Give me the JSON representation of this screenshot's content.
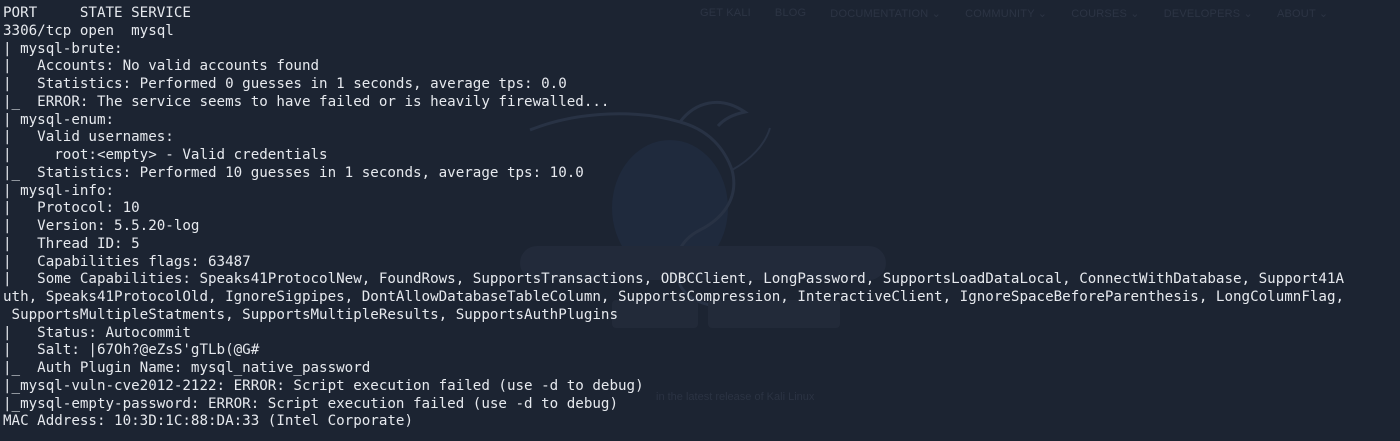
{
  "background": {
    "nav_items": [
      "GET KALI",
      "BLOG",
      "DOCUMENTATION ⌄",
      "COMMUNITY ⌄",
      "COURSES ⌄",
      "DEVELOPERS ⌄",
      "ABOUT ⌄"
    ],
    "footer_text": "in the latest release of Kali Linux"
  },
  "terminal": {
    "lines": [
      "PORT     STATE SERVICE",
      "3306/tcp open  mysql",
      "| mysql-brute:",
      "|   Accounts: No valid accounts found",
      "|   Statistics: Performed 0 guesses in 1 seconds, average tps: 0.0",
      "|_  ERROR: The service seems to have failed or is heavily firewalled...",
      "| mysql-enum:",
      "|   Valid usernames:",
      "|     root:<empty> - Valid credentials",
      "|_  Statistics: Performed 10 guesses in 1 seconds, average tps: 10.0",
      "| mysql-info:",
      "|   Protocol: 10",
      "|   Version: 5.5.20-log",
      "|   Thread ID: 5",
      "|   Capabilities flags: 63487",
      "|   Some Capabilities: Speaks41ProtocolNew, FoundRows, SupportsTransactions, ODBCClient, LongPassword, SupportsLoadDataLocal, ConnectWithDatabase, Support41A",
      "uth, Speaks41ProtocolOld, IgnoreSigpipes, DontAllowDatabaseTableColumn, SupportsCompression, InteractiveClient, IgnoreSpaceBeforeParenthesis, LongColumnFlag,",
      " SupportsMultipleStatments, SupportsMultipleResults, SupportsAuthPlugins",
      "|   Status: Autocommit",
      "|   Salt: |67Oh?@eZsS'gTLb(@G#",
      "|_  Auth Plugin Name: mysql_native_password",
      "|_mysql-vuln-cve2012-2122: ERROR: Script execution failed (use -d to debug)",
      "|_mysql-empty-password: ERROR: Script execution failed (use -d to debug)",
      "MAC Address: 10:3D:1C:88:DA:33 (Intel Corporate)"
    ]
  }
}
